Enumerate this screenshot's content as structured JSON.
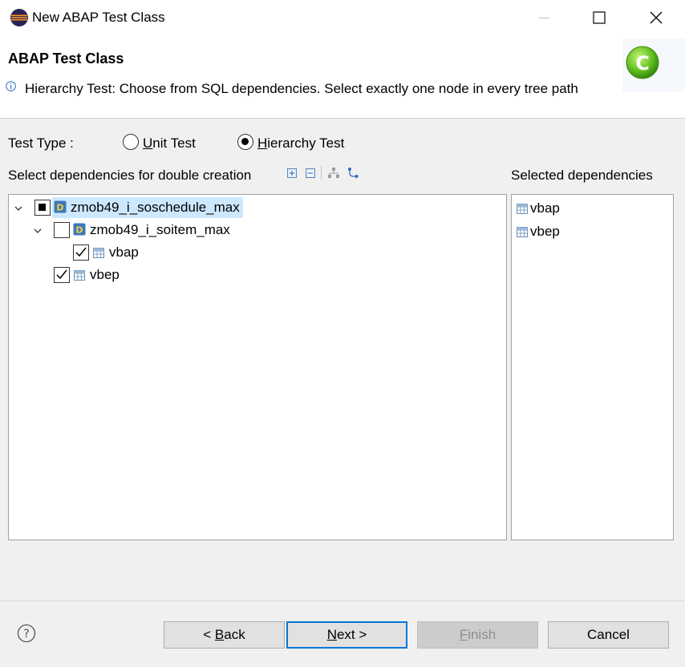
{
  "window": {
    "title": "New ABAP Test Class",
    "icons": {
      "app": "eclipse-icon",
      "minimize": "minimize-icon",
      "maximize": "maximize-icon",
      "close": "close-icon"
    }
  },
  "header": {
    "title": "ABAP Test Class",
    "message": "Hierarchy Test: Choose from SQL dependencies. Select exactly one node in every tree path",
    "info_icon": "info-icon",
    "logo_icon": "abap-class-logo-icon"
  },
  "test_type": {
    "label": "Test Type :",
    "options": [
      {
        "label_first": "U",
        "label_rest": "nit Test",
        "selected": false
      },
      {
        "label_first": "H",
        "label_rest": "ierarchy Test",
        "selected": true
      }
    ]
  },
  "dependencies": {
    "label": "Select dependencies for double creation",
    "toolbar": [
      "expand-all-icon",
      "collapse-all-icon",
      "hierarchy-icon",
      "show-path-icon"
    ],
    "tree": [
      {
        "label": "zmob49_i_soschedule_max",
        "icon": "cds-view-icon",
        "state": "partial",
        "expanded": true,
        "selected_row": true
      },
      {
        "label": "zmob49_i_soitem_max",
        "icon": "cds-view-icon",
        "state": "unchecked",
        "expanded": true
      },
      {
        "label": "vbap",
        "icon": "table-icon",
        "state": "checked"
      },
      {
        "label": "vbep",
        "icon": "table-icon",
        "state": "checked"
      }
    ]
  },
  "selected": {
    "label": "Selected dependencies",
    "items": [
      {
        "label": "vbap",
        "icon": "table-icon"
      },
      {
        "label": "vbep",
        "icon": "table-icon"
      }
    ]
  },
  "buttons": {
    "help_icon": "help-icon",
    "back_prefix": "< ",
    "back_u": "B",
    "back_rest": "ack",
    "next_u": "N",
    "next_rest": "ext >",
    "finish_u": "F",
    "finish_rest": "inish",
    "cancel": "Cancel"
  },
  "colors": {
    "accent": "#0078d7",
    "selection": "#cce8ff"
  }
}
